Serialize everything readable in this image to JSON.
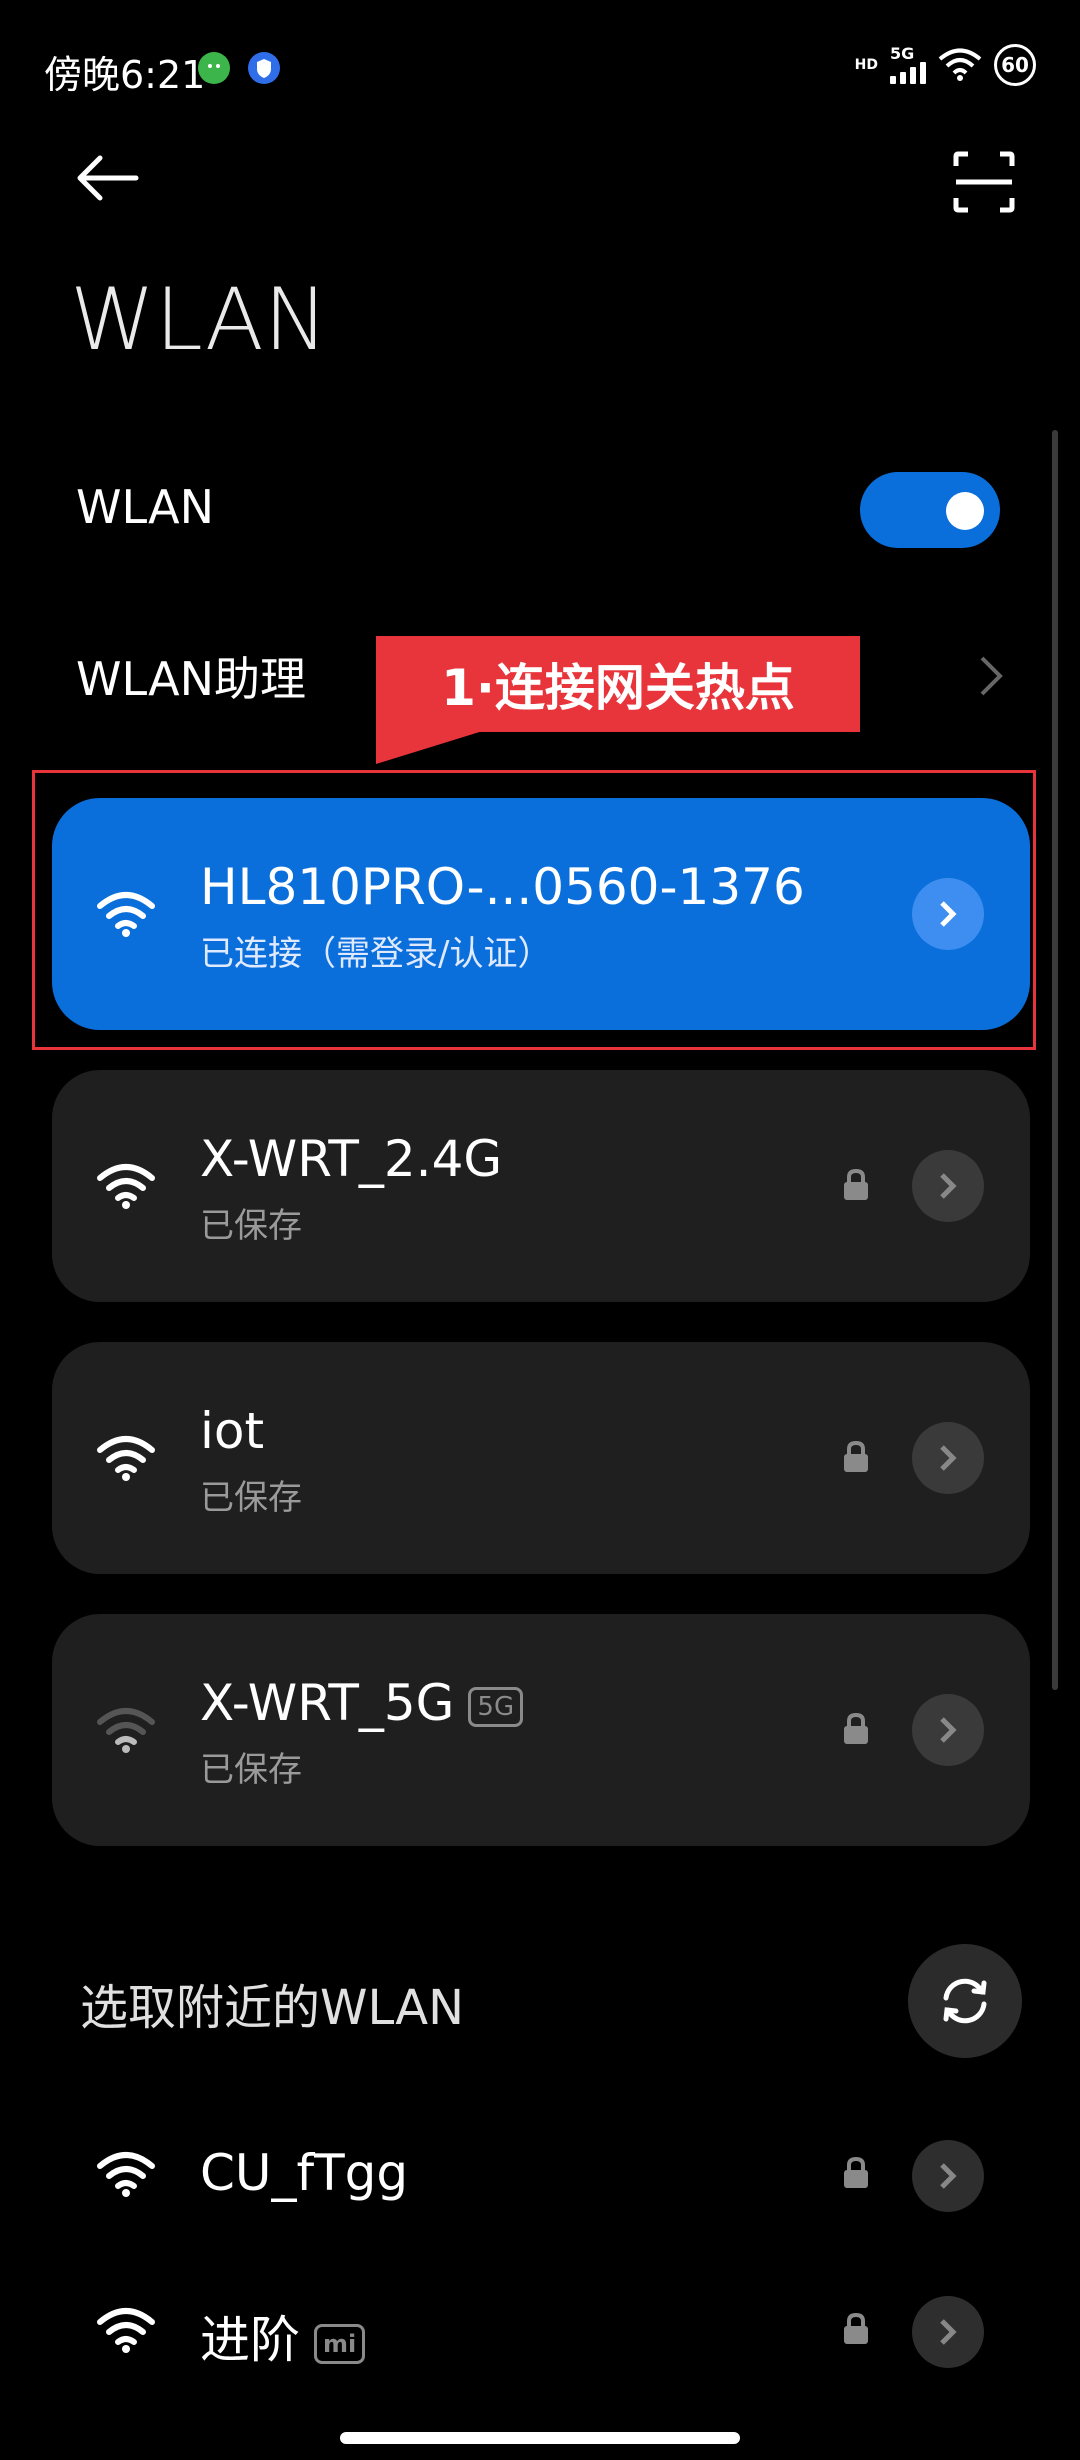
{
  "status_bar": {
    "time": "傍晚6:21",
    "network_label": "5G",
    "hd_label": "HD",
    "battery": "60"
  },
  "header": {
    "title": "WLAN"
  },
  "wlan_toggle": {
    "label": "WLAN",
    "enabled": true
  },
  "assistant": {
    "label": "WLAN助理"
  },
  "annotation": {
    "callout_text": "1·连接网关热点",
    "color": "#e8343b"
  },
  "saved_networks": [
    {
      "ssid": "HL810PRO-...0560-1376",
      "status": "已连接（需登录/认证）",
      "connected": true,
      "locked": false,
      "signal": "full"
    },
    {
      "ssid": "X-WRT_2.4G",
      "status": "已保存",
      "connected": false,
      "locked": true,
      "signal": "full"
    },
    {
      "ssid": "iot",
      "status": "已保存",
      "connected": false,
      "locked": true,
      "signal": "full"
    },
    {
      "ssid": "X-WRT_5G",
      "badge": "5G",
      "status": "已保存",
      "connected": false,
      "locked": true,
      "signal": "weak"
    }
  ],
  "nearby": {
    "title": "选取附近的WLAN",
    "networks": [
      {
        "ssid": "CU_fTgg",
        "locked": true
      },
      {
        "ssid": "进阶",
        "badge": "mi",
        "locked": true
      }
    ]
  },
  "colors": {
    "accent": "#0a6fdb",
    "card": "#1f1f1f",
    "background": "#000000"
  }
}
